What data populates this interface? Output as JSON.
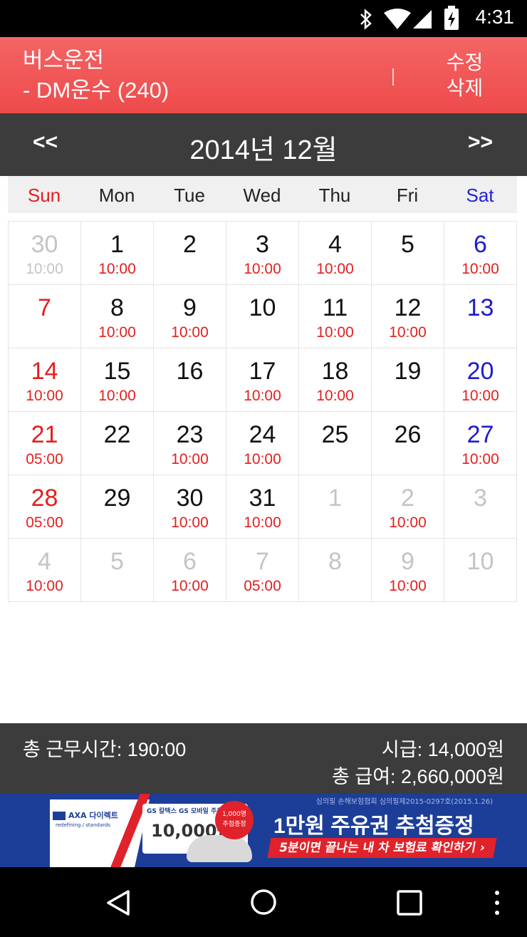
{
  "status_bar": {
    "time": "4:31",
    "icons": [
      "bluetooth-icon",
      "wifi-icon",
      "cell-signal-icon",
      "battery-icon"
    ]
  },
  "app_bar": {
    "title_line1": "버스운전",
    "title_line2": "- DM운수 (240)",
    "edit_label": "수정",
    "delete_label": "삭제",
    "background_color": "#f05555"
  },
  "month_nav": {
    "prev_label": "<<",
    "next_label": ">>",
    "title": "2014년 12월"
  },
  "weekdays": [
    "Sun",
    "Mon",
    "Tue",
    "Wed",
    "Thu",
    "Fri",
    "Sat"
  ],
  "colors": {
    "sunday": "#e41e1e",
    "saturday": "#1c1ccc",
    "shift_time": "#e41e1e",
    "other_month": "#c4c4c4"
  },
  "calendar": {
    "weeks": [
      [
        {
          "day": "30",
          "time": "10:00",
          "other_month": true
        },
        {
          "day": "1",
          "time": "10:00"
        },
        {
          "day": "2",
          "time": ""
        },
        {
          "day": "3",
          "time": "10:00"
        },
        {
          "day": "4",
          "time": "10:00"
        },
        {
          "day": "5",
          "time": ""
        },
        {
          "day": "6",
          "time": "10:00"
        }
      ],
      [
        {
          "day": "7",
          "time": ""
        },
        {
          "day": "8",
          "time": "10:00"
        },
        {
          "day": "9",
          "time": "10:00"
        },
        {
          "day": "10",
          "time": ""
        },
        {
          "day": "11",
          "time": "10:00"
        },
        {
          "day": "12",
          "time": "10:00"
        },
        {
          "day": "13",
          "time": ""
        }
      ],
      [
        {
          "day": "14",
          "time": "10:00"
        },
        {
          "day": "15",
          "time": "10:00"
        },
        {
          "day": "16",
          "time": ""
        },
        {
          "day": "17",
          "time": "10:00"
        },
        {
          "day": "18",
          "time": "10:00"
        },
        {
          "day": "19",
          "time": ""
        },
        {
          "day": "20",
          "time": "10:00"
        }
      ],
      [
        {
          "day": "21",
          "time": "05:00"
        },
        {
          "day": "22",
          "time": ""
        },
        {
          "day": "23",
          "time": "10:00"
        },
        {
          "day": "24",
          "time": "10:00"
        },
        {
          "day": "25",
          "time": ""
        },
        {
          "day": "26",
          "time": ""
        },
        {
          "day": "27",
          "time": "10:00"
        }
      ],
      [
        {
          "day": "28",
          "time": "05:00"
        },
        {
          "day": "29",
          "time": ""
        },
        {
          "day": "30",
          "time": "10:00"
        },
        {
          "day": "31",
          "time": "10:00"
        },
        {
          "day": "1",
          "time": "",
          "other_month": true
        },
        {
          "day": "2",
          "time": "10:00",
          "other_month": true
        },
        {
          "day": "3",
          "time": "",
          "other_month": true
        }
      ],
      [
        {
          "day": "4",
          "time": "10:00",
          "other_month": true
        },
        {
          "day": "5",
          "time": "",
          "other_month": true
        },
        {
          "day": "6",
          "time": "10:00",
          "other_month": true
        },
        {
          "day": "7",
          "time": "05:00",
          "other_month": true
        },
        {
          "day": "8",
          "time": "",
          "other_month": true
        },
        {
          "day": "9",
          "time": "10:00",
          "other_month": true
        },
        {
          "day": "10",
          "time": "",
          "other_month": true
        }
      ]
    ]
  },
  "summary": {
    "total_hours": "총 근무시간: 190:00",
    "hourly_wage": "시급: 14,000원",
    "total_pay": "총 급여: 2,660,000원"
  },
  "ad_banner": {
    "brand": "AXA 다이렉트",
    "tagline": "redefining / standards",
    "gs_text": "GS 칼텍스 GS 모바일 주유권",
    "amount": "10,000원",
    "badge_line1": "1,000명",
    "badge_line2": "추첨증정",
    "headline": "1만원 주유권 추첨증정",
    "subline": "5분이면 끝나는 내 차 보험료 확인하기 ›",
    "notice": "심의필 손해보험협회 심의필제2015-0297호(2015.1.26)"
  },
  "nav_bar": {
    "icons": [
      "back-icon",
      "home-icon",
      "recents-icon",
      "overflow-menu-icon"
    ]
  }
}
